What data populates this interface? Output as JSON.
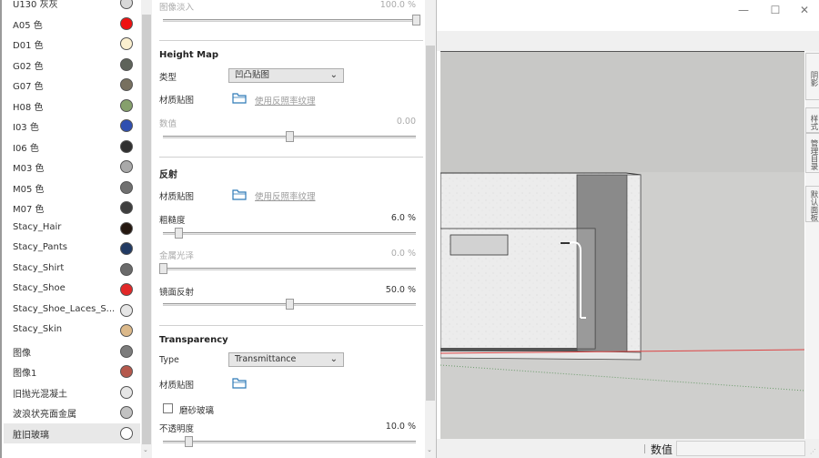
{
  "window": {
    "controls": {
      "minimize": "—",
      "maximize": "☐",
      "close": "✕"
    }
  },
  "tray_tabs": [
    "阴影",
    "样式",
    "管理目录",
    "默认面板"
  ],
  "statusbar": {
    "label": "数值",
    "value": ""
  },
  "materials": {
    "items": [
      {
        "name": "U130 灰灰",
        "color": "#d8d8d8"
      },
      {
        "name": "A05 色",
        "color": "#ee1111"
      },
      {
        "name": "D01 色",
        "color": "#fbefcf"
      },
      {
        "name": "G02 色",
        "color": "#5e635a"
      },
      {
        "name": "G07 色",
        "color": "#77705f"
      },
      {
        "name": "H08 色",
        "color": "#86a06c"
      },
      {
        "name": "I03 色",
        "color": "#2f4fb0"
      },
      {
        "name": "I06 色",
        "color": "#303030"
      },
      {
        "name": "M03 色",
        "color": "#a9a9a9"
      },
      {
        "name": "M05 色",
        "color": "#707070"
      },
      {
        "name": "M07 色",
        "color": "#3e3e3e"
      },
      {
        "name": "Stacy_Hair",
        "color": "#24170f"
      },
      {
        "name": "Stacy_Pants",
        "color": "#213a63"
      },
      {
        "name": "Stacy_Shirt",
        "color": "#6a6a6a"
      },
      {
        "name": "Stacy_Shoe",
        "color": "#e22828"
      },
      {
        "name": "Stacy_Shoe_Laces_S...",
        "color": "#e6e6e6"
      },
      {
        "name": "Stacy_Skin",
        "color": "#dcb98a"
      },
      {
        "name": "图像",
        "color": "#7c7c7c"
      },
      {
        "name": "图像1",
        "color": "#b5584c"
      },
      {
        "name": "旧抛光混凝土",
        "color": "#e6e6e6"
      },
      {
        "name": "波浪状亮面金属",
        "color": "#c2c2c2"
      },
      {
        "name": "脏旧玻璃",
        "color": "#ffffff"
      }
    ],
    "selected_index": 21
  },
  "properties": {
    "image_fade": {
      "label": "图像淡入",
      "value": "100.0 %",
      "fraction": 1.0
    },
    "height_map": {
      "title": "Height Map",
      "type_label": "类型",
      "type_value": "凹凸贴图",
      "texture_label": "材质贴图",
      "texture_link": "使用反照率纹理",
      "amount_label": "数值",
      "amount_value": "0.00",
      "amount_fraction": 0.5
    },
    "reflection": {
      "title": "反射",
      "texture_label": "材质贴图",
      "texture_link": "使用反照率纹理",
      "roughness_label": "粗糙度",
      "roughness_value": "6.0 %",
      "roughness_fraction": 0.06,
      "metallic_label": "金属光泽",
      "metallic_value": "0.0 %",
      "metallic_fraction": 0.0,
      "specular_label": "镜面反射",
      "specular_value": "50.0 %",
      "specular_fraction": 0.5
    },
    "transparency": {
      "title": "Transparency",
      "type_label": "Type",
      "type_value": "Transmittance",
      "texture_label": "材质贴图",
      "frosted_label": "磨砂玻璃",
      "frosted_checked": false,
      "opacity_label": "不透明度",
      "opacity_value": "10.0 %",
      "opacity_fraction": 0.1
    }
  }
}
